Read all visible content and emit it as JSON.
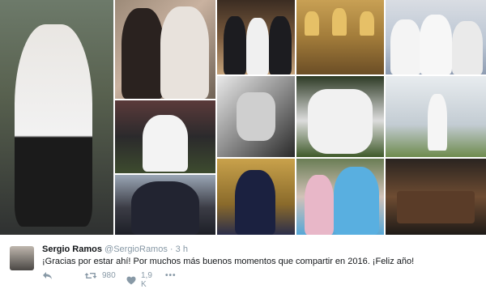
{
  "tweet": {
    "name": "Sergio Ramos",
    "handle": "@SergioRamos",
    "time": "3 h",
    "text": "¡Gracias por estar ahí! Por muchos más buenos momentos que compartir en 2016. ¡Feliz año!",
    "retweets": "980",
    "likes": "1,9 K"
  },
  "icons": [
    "reply-icon",
    "retweet-icon",
    "heart-icon",
    "more-icon"
  ],
  "colors": {
    "muted": "#8899a6",
    "text": "#14171a"
  }
}
